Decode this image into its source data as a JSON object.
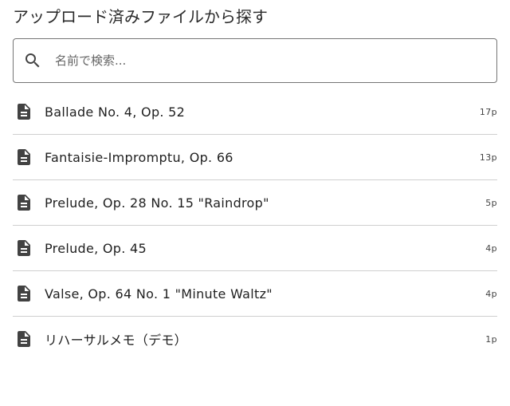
{
  "header": {
    "title": "アップロード済みファイルから探す"
  },
  "search": {
    "icon": "search-icon",
    "placeholder": "名前で検索...",
    "value": ""
  },
  "files": [
    {
      "name": "Ballade No. 4, Op. 52",
      "pages": "17p",
      "icon": "document-icon"
    },
    {
      "name": "Fantaisie-Impromptu, Op. 66",
      "pages": "13p",
      "icon": "document-icon"
    },
    {
      "name": "Prelude, Op. 28 No. 15 \"Raindrop\"",
      "pages": "5p",
      "icon": "document-icon"
    },
    {
      "name": "Prelude, Op. 45",
      "pages": "4p",
      "icon": "document-icon"
    },
    {
      "name": "Valse, Op. 64 No. 1 \"Minute Waltz\"",
      "pages": "4p",
      "icon": "document-icon"
    },
    {
      "name": "リハーサルメモ（デモ）",
      "pages": "1p",
      "icon": "document-icon"
    }
  ],
  "colors": {
    "icon": "#424242",
    "border": "#757575",
    "divider": "#cfcfcf"
  }
}
